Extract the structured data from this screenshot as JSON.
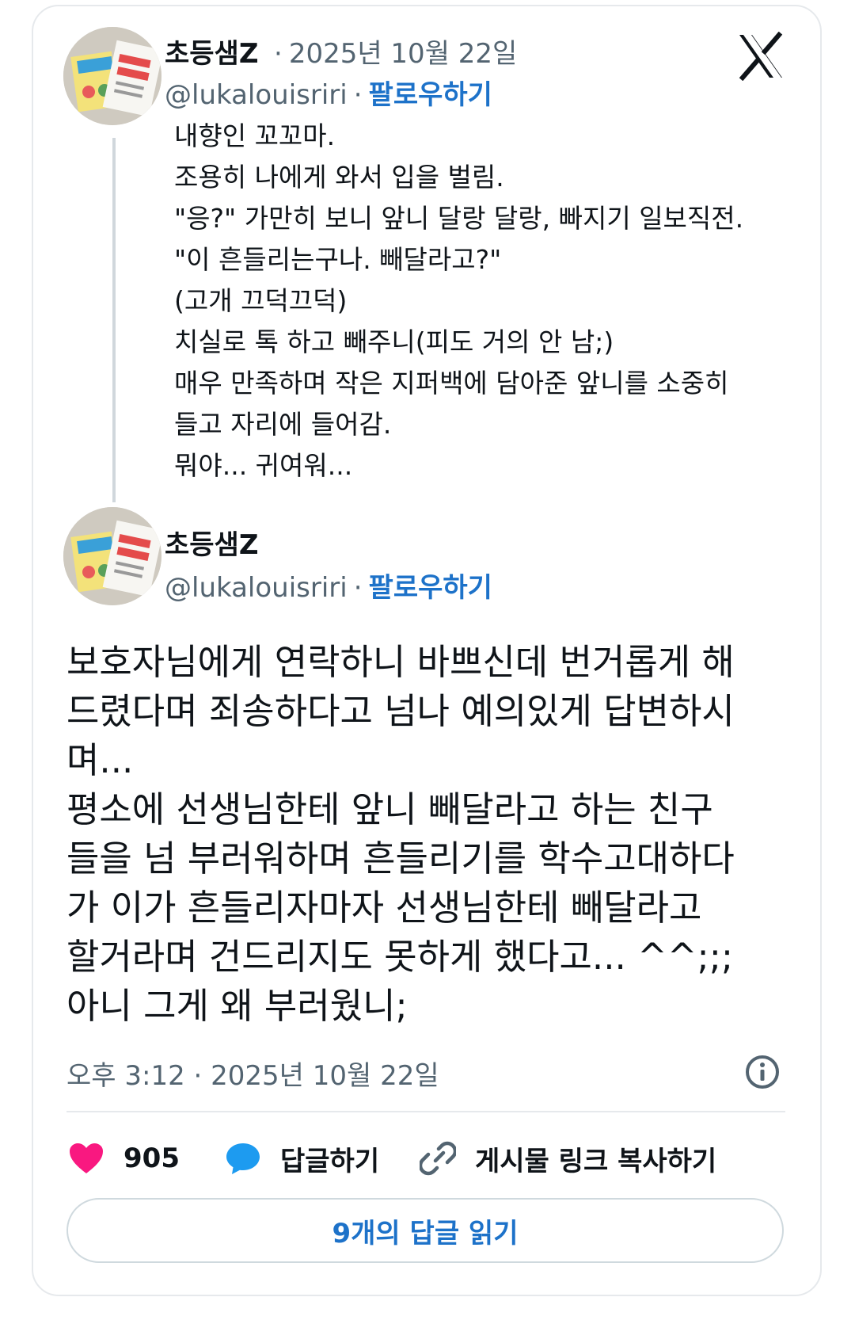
{
  "quoted_tweet": {
    "author_name": "초등샘Z",
    "date": "2025년 10월 22일",
    "handle": "@lukalouisriri",
    "follow_label": "팔로우하기",
    "text_lines": [
      "내향인 꼬꼬마.",
      "조용히 나에게 와서 입을 벌림.",
      "\"응?\" 가만히 보니 앞니 달랑 달랑, 빠지기 일보직전.",
      "\"이 흔들리는구나. 빼달라고?\"",
      "(고개 끄덕끄덕)",
      "치실로 톡 하고 빼주니(피도 거의 안 남;)",
      "매우 만족하며 작은 지퍼백에 담아준 앞니를 소중히",
      "들고 자리에 들어감.",
      "뭐야... 귀여워..."
    ]
  },
  "main_tweet": {
    "author_name": "초등샘Z",
    "handle": "@lukalouisriri",
    "follow_label": "팔로우하기",
    "text_lines": [
      "보호자님에게 연락하니 바쁘신데 번거롭게 해",
      "드렸다며 죄송하다고 넘나 예의있게 답변하시",
      "며...",
      "평소에 선생님한테 앞니 빼달라고 하는 친구",
      "들을 넘 부러워하며 흔들리기를 학수고대하다",
      "가 이가 흔들리자마자 선생님한테 빼달라고",
      "할거라며 건드리지도 못하게 했다고... ^^;;;",
      "아니 그게 왜 부러웠니;"
    ],
    "timestamp": "오후 3:12 · 2025년 10월 22일"
  },
  "actions": {
    "like_count": "905",
    "reply_label": "답글하기",
    "copy_link_label": "게시물 링크 복사하기"
  },
  "read_replies_label": "9개의 답글 읽기",
  "colors": {
    "like": "#f91880",
    "reply": "#1d9bf0",
    "link": "#1d72c9",
    "muted": "#536471"
  },
  "icons": {
    "logo": "x-logo-icon",
    "info": "info-icon",
    "like": "heart-icon",
    "reply": "speech-bubble-icon",
    "link": "link-icon"
  }
}
